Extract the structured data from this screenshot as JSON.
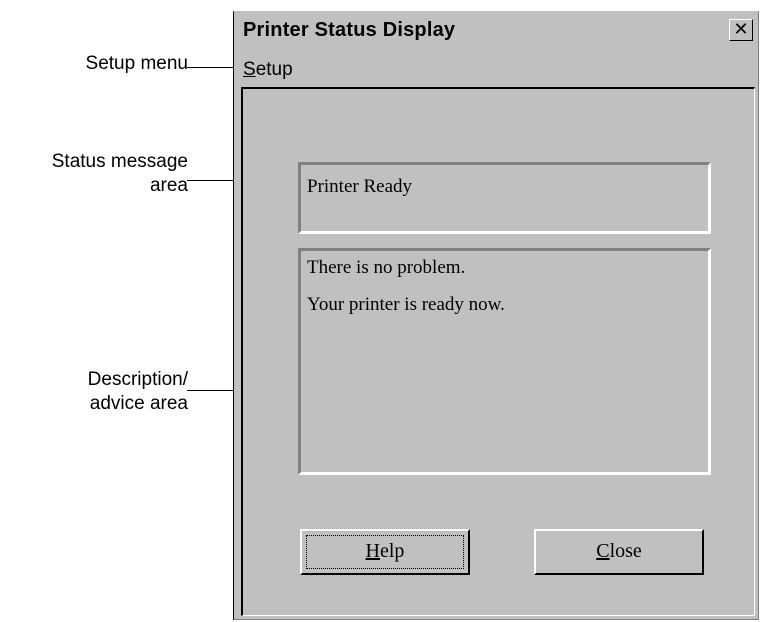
{
  "annotations": {
    "setup_menu": "Setup menu",
    "status_area_line1": "Status message",
    "status_area_line2": "area",
    "description_line1": "Description/",
    "description_line2": "advice area"
  },
  "window": {
    "title": "Printer Status Display",
    "close_glyph": "✕"
  },
  "menu": {
    "setup_mnemonic": "S",
    "setup_rest": "etup"
  },
  "status": {
    "message": "Printer Ready"
  },
  "description": {
    "lines": [
      "There is no problem.",
      "Your printer is ready now."
    ]
  },
  "buttons": {
    "help_mnemonic": "H",
    "help_rest": "elp",
    "close_mnemonic": "C",
    "close_rest": "lose"
  },
  "icons": {
    "close": "close-icon"
  },
  "colors": {
    "window_bg": "#c0c0c0",
    "panel_shadow": "#808080",
    "panel_highlight": "#ffffff"
  }
}
